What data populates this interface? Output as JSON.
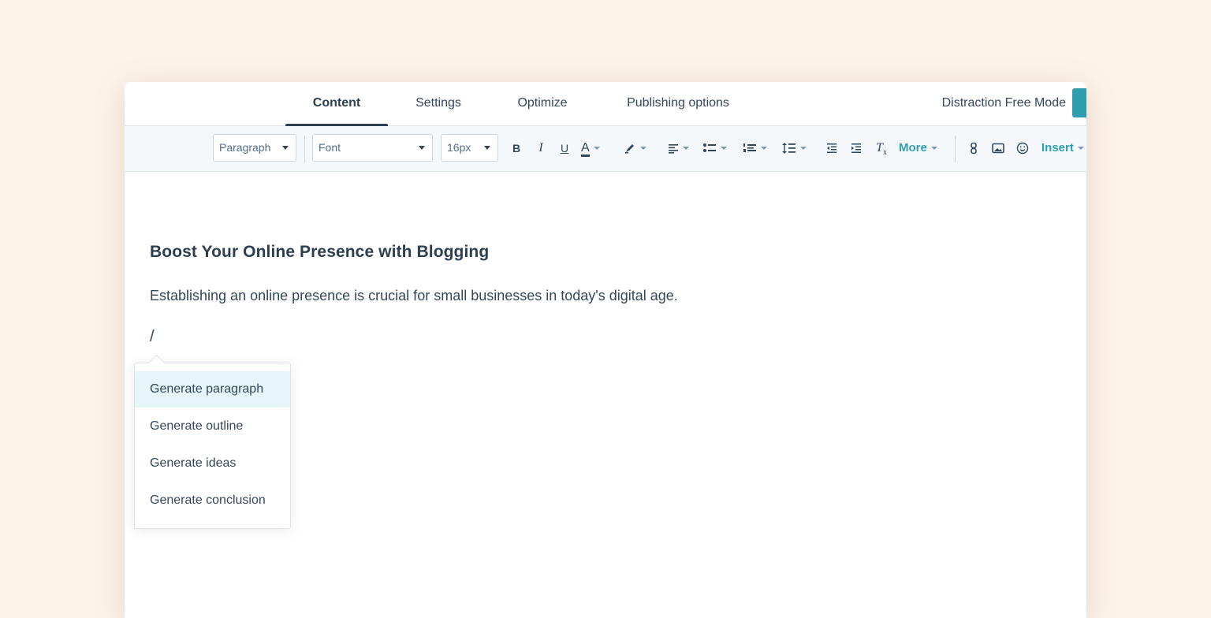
{
  "tabs": {
    "content": "Content",
    "settings": "Settings",
    "optimize": "Optimize",
    "publishing": "Publishing options",
    "active": "Content"
  },
  "header": {
    "distraction_free": "Distraction Free Mode"
  },
  "toolbar": {
    "block_format": "Paragraph",
    "font": "Font",
    "font_size": "16px",
    "bold": "B",
    "italic": "I",
    "underline": "U",
    "text_color": "A",
    "clear_format": "T",
    "clear_format_sub": "x",
    "more": "More",
    "insert": "Insert",
    "icons": [
      "bold-icon",
      "italic-icon",
      "underline-icon",
      "text-color-icon",
      "highlight-icon",
      "align-icon",
      "bulleted-list-icon",
      "numbered-list-icon",
      "line-height-icon",
      "outdent-icon",
      "indent-icon",
      "clear-formatting-icon",
      "link-icon",
      "image-icon",
      "emoji-icon"
    ]
  },
  "document": {
    "heading": "Boost Your Online Presence with Blogging",
    "paragraph": "Establishing an online presence is crucial for small businesses in today's digital age.",
    "command": "/"
  },
  "slash_menu": {
    "items": [
      "Generate paragraph",
      "Generate outline",
      "Generate ideas",
      "Generate conclusion"
    ],
    "highlighted_index": 0
  },
  "colors": {
    "background": "#fdf3e9",
    "accent": "#2f9fb0",
    "text": "#33475b",
    "highlight": "#e5f5f8"
  }
}
